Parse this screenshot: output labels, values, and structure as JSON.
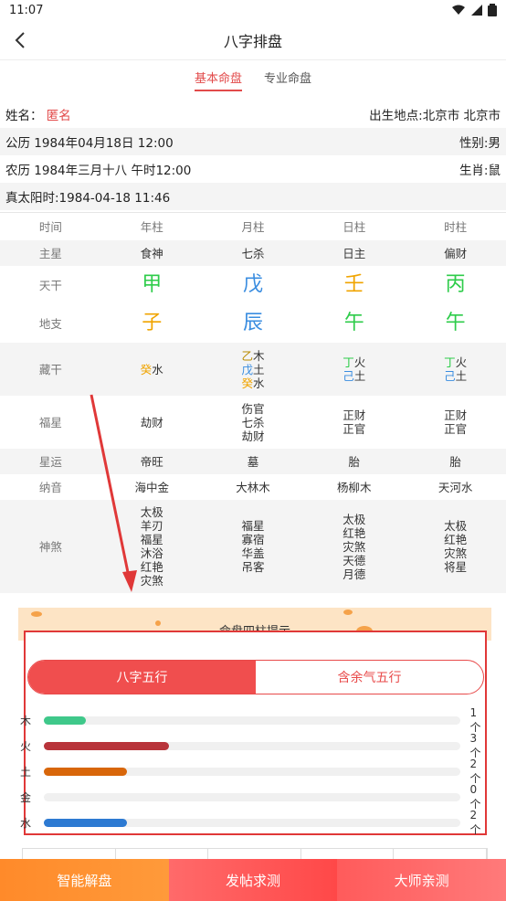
{
  "status": {
    "time": "11:07"
  },
  "nav": {
    "title": "八字排盘"
  },
  "tabs": [
    {
      "label": "基本命盘",
      "active": true
    },
    {
      "label": "专业命盘",
      "active": false
    }
  ],
  "info": {
    "name_label": "姓名：",
    "name_value": "匿名",
    "birthplace": "出生地点:北京市 北京市",
    "solar": "公历 1984年04月18日 12:00",
    "gender": "性别:男",
    "lunar": "农历 1984年三月十八 午时12:00",
    "zodiac": "生肖:鼠",
    "true_solar": "真太阳时:1984-04-18 11:46"
  },
  "pillars": {
    "headers": [
      "时间",
      "年柱",
      "月柱",
      "日柱",
      "时柱"
    ],
    "row_labels": {
      "main_star": "主星",
      "stem": "天干",
      "branch": "地支",
      "hidden": "藏干",
      "fortune": "福星",
      "star_luck": "星运",
      "nayin": "纳音",
      "shensha": "神煞"
    },
    "main_star": [
      "食神",
      "七杀",
      "日主",
      "偏财"
    ],
    "stems": [
      {
        "char": "甲",
        "el": "wood"
      },
      {
        "char": "戊",
        "el": "water"
      },
      {
        "char": "壬",
        "el": "metal"
      },
      {
        "char": "丙",
        "el": "wood"
      }
    ],
    "branches": [
      {
        "char": "子",
        "el": "metal"
      },
      {
        "char": "辰",
        "el": "water"
      },
      {
        "char": "午",
        "el": "wood"
      },
      {
        "char": "午",
        "el": "wood"
      }
    ],
    "hidden": [
      [
        {
          "g": "癸",
          "e": "水",
          "el": "metal"
        }
      ],
      [
        {
          "g": "乙",
          "e": "木",
          "el": "earth"
        },
        {
          "g": "戊",
          "e": "土",
          "el": "water"
        },
        {
          "g": "癸",
          "e": "水",
          "el": "metal"
        }
      ],
      [
        {
          "g": "丁",
          "e": "火",
          "el": "wood"
        },
        {
          "g": "己",
          "e": "土",
          "el": "water"
        }
      ],
      [
        {
          "g": "丁",
          "e": "火",
          "el": "wood"
        },
        {
          "g": "己",
          "e": "土",
          "el": "water"
        }
      ]
    ],
    "fortune": [
      "劫财",
      "伤官\n七杀\n劫财",
      "正财\n正官",
      "正财\n正官"
    ],
    "star_luck": [
      "帝旺",
      "墓",
      "胎",
      "胎"
    ],
    "nayin": [
      "海中金",
      "大林木",
      "杨柳木",
      "天河水"
    ],
    "shensha": [
      "太极\n羊刃\n福星\n沐浴\n红艳\n灾煞",
      "福星\n寡宿\n华盖\n吊客",
      "太极\n红艳\n灾煞\n天德\n月德",
      "太极\n红艳\n灾煞\n将星"
    ]
  },
  "hint": {
    "title": "命盘四柱提示"
  },
  "wuxing": {
    "switch": [
      {
        "label": "八字五行",
        "active": true
      },
      {
        "label": "含余气五行",
        "active": false
      }
    ],
    "max": 10,
    "bars": [
      {
        "label": "木",
        "count": 1,
        "count_label": "1个",
        "color": "#3fc88a"
      },
      {
        "label": "火",
        "count": 3,
        "count_label": "3个",
        "color": "#b8343a"
      },
      {
        "label": "土",
        "count": 2,
        "count_label": "2个",
        "color": "#d8660a"
      },
      {
        "label": "金",
        "count": 0,
        "count_label": "0个",
        "color": "#f0b000"
      },
      {
        "label": "水",
        "count": 2,
        "count_label": "2个",
        "color": "#2d7ad2"
      }
    ]
  },
  "bottom": {
    "btn1": "智能解盘",
    "btn2": "发帖求测",
    "btn3": "大师亲测"
  },
  "colors": {
    "wood": "#2ecc4a",
    "fire": "#e03838",
    "earth": "#b88a00",
    "metal": "#f0a400",
    "water": "#3a8de0",
    "accent": "#e24a4a"
  }
}
